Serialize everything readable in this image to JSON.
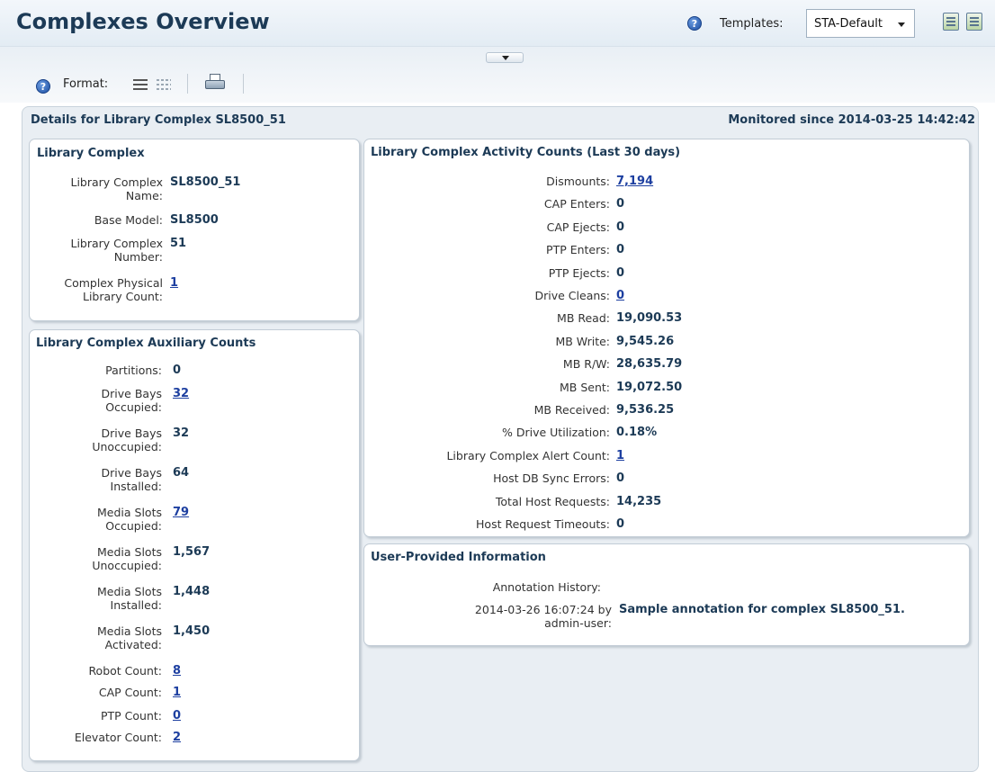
{
  "header": {
    "title": "Complexes Overview",
    "templates_label": "Templates:",
    "template_selected": "STA-Default"
  },
  "toolbar": {
    "format_label": "Format:"
  },
  "details": {
    "title": "Details for Library Complex SL8500_51",
    "monitored": "Monitored since 2014-03-25 14:42:42"
  },
  "library_complex": {
    "title": "Library Complex",
    "rows": [
      {
        "label1": "Library Complex",
        "label2": "Name:",
        "value": "SL8500_51"
      },
      {
        "label1": "Base Model:",
        "label2": "",
        "value": "SL8500"
      },
      {
        "label1": "Library Complex",
        "label2": "Number:",
        "value": "51"
      },
      {
        "label1": "Complex Physical",
        "label2": "Library Count:",
        "value": "1"
      }
    ]
  },
  "aux_counts": {
    "title": "Library Complex Auxiliary Counts",
    "rows": [
      {
        "label1": "Partitions:",
        "label2": "",
        "value": "0"
      },
      {
        "label1": "Drive Bays",
        "label2": "Occupied:",
        "value": "32"
      },
      {
        "label1": "Drive Bays",
        "label2": "Unoccupied:",
        "value": "32"
      },
      {
        "label1": "Drive Bays",
        "label2": "Installed:",
        "value": "64"
      },
      {
        "label1": "Media Slots",
        "label2": "Occupied:",
        "value": "79"
      },
      {
        "label1": "Media Slots",
        "label2": "Unoccupied:",
        "value": "1,567"
      },
      {
        "label1": "Media Slots",
        "label2": "Installed:",
        "value": "1,448"
      },
      {
        "label1": "Media Slots",
        "label2": "Activated:",
        "value": "1,450"
      },
      {
        "label1": "Robot Count:",
        "label2": "",
        "value": "8"
      },
      {
        "label1": "CAP Count:",
        "label2": "",
        "value": "1"
      },
      {
        "label1": "PTP Count:",
        "label2": "",
        "value": "0"
      },
      {
        "label1": "Elevator Count:",
        "label2": "",
        "value": "2"
      }
    ]
  },
  "activity": {
    "title": "Library Complex Activity Counts (Last 30 days)",
    "rows": [
      {
        "label": "Dismounts:",
        "value": "7,194"
      },
      {
        "label": "CAP Enters:",
        "value": "0"
      },
      {
        "label": "CAP Ejects:",
        "value": "0"
      },
      {
        "label": "PTP Enters:",
        "value": "0"
      },
      {
        "label": "PTP Ejects:",
        "value": "0"
      },
      {
        "label": "Drive Cleans:",
        "value": "0"
      },
      {
        "label": "MB Read:",
        "value": "19,090.53"
      },
      {
        "label": "MB Write:",
        "value": "9,545.26"
      },
      {
        "label": "MB R/W:",
        "value": "28,635.79"
      },
      {
        "label": "MB Sent:",
        "value": "19,072.50"
      },
      {
        "label": "MB Received:",
        "value": "9,536.25"
      },
      {
        "label": "% Drive Utilization:",
        "value": "0.18%"
      },
      {
        "label": "Library Complex Alert Count:",
        "value": "1"
      },
      {
        "label": "Host DB Sync Errors:",
        "value": "0"
      },
      {
        "label": "Total Host Requests:",
        "value": "14,235"
      },
      {
        "label": "Host Request Timeouts:",
        "value": "0"
      }
    ]
  },
  "user_info": {
    "title": "User-Provided Information",
    "history_label": "Annotation History:",
    "entry_time": "2014-03-26 16:07:24 by",
    "entry_user": "admin-user:",
    "entry_text": "Sample annotation for complex SL8500_51."
  }
}
